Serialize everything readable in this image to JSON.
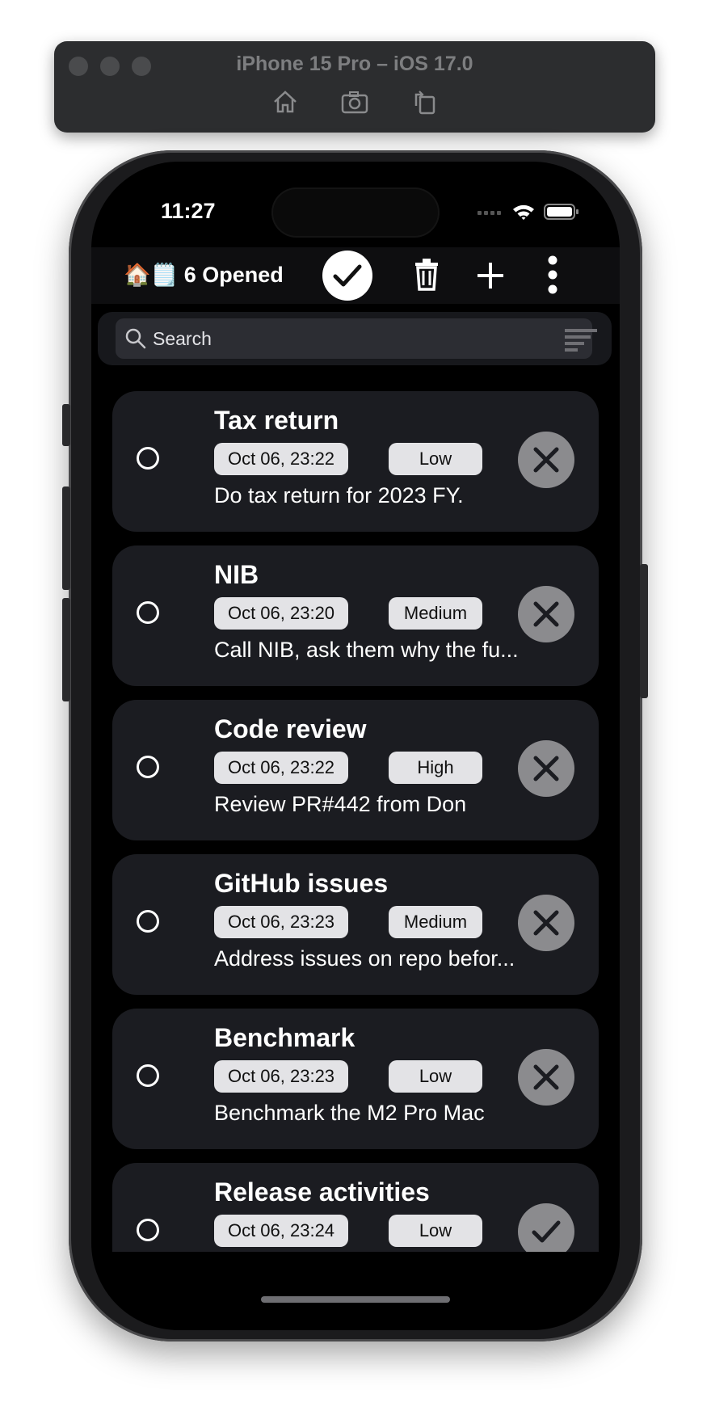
{
  "simulator": {
    "title": "iPhone 15 Pro – iOS 17.0",
    "tools": [
      "home-icon",
      "screenshot-icon",
      "rotate-icon"
    ]
  },
  "status_bar": {
    "time": "11:27"
  },
  "navbar": {
    "title": "🏠🗒️ 6 Opened",
    "icons": [
      "check-circle-icon",
      "trash-icon",
      "plus-icon",
      "more-vertical-icon"
    ]
  },
  "search": {
    "placeholder": "Search"
  },
  "tasks": [
    {
      "title": "Tax return",
      "date": "Oct 06, 23:22",
      "priority": "Low",
      "description": "Do tax return for 2023 FY.",
      "action": "close-icon"
    },
    {
      "title": "NIB",
      "date": "Oct 06, 23:20",
      "priority": "Medium",
      "description": "Call NIB, ask them why the fu...",
      "action": "close-icon"
    },
    {
      "title": "Code review",
      "date": "Oct 06, 23:22",
      "priority": "High",
      "description": "Review PR#442 from Don",
      "action": "close-icon"
    },
    {
      "title": "GitHub issues",
      "date": "Oct 06, 23:23",
      "priority": "Medium",
      "description": "Address issues on repo befor...",
      "action": "close-icon"
    },
    {
      "title": "Benchmark",
      "date": "Oct 06, 23:23",
      "priority": "Low",
      "description": "Benchmark the M2 Pro Mac",
      "action": "close-icon"
    },
    {
      "title": "Release activities",
      "date": "Oct 06, 23:24",
      "priority": "Low",
      "description": "",
      "action": "checkmark-icon"
    }
  ],
  "colors": {
    "screen_bg": "#000000",
    "card_bg": "#1b1c21",
    "chip_bg": "#e3e3e6",
    "action_button": "#8b8b8e"
  }
}
